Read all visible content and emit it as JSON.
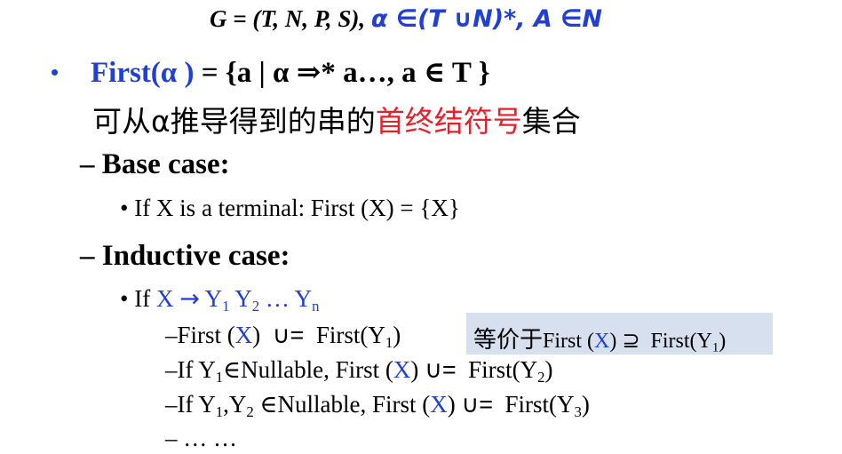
{
  "grammar": {
    "lhs": "G = (T, N, P, S),",
    "alpha_cond": "α ∈(T ∪N)*, A ∈N"
  },
  "first_def": {
    "bullet": "•",
    "head": "First(α )",
    "body": " = {a | α ⇒* a…, a ∈ T }",
    "desc_pre": "可从α推导得到的串的",
    "desc_red": "首终结符号",
    "desc_post": "集合"
  },
  "base_case": {
    "heading": "– Base case:",
    "item": "• If X is a terminal: First (X) = {X}"
  },
  "inductive_case": {
    "heading": "– Inductive case:",
    "item_prefix": "• If ",
    "prod_lhs": "X",
    "arrow": "→",
    "y": "Y",
    "sub1": "1",
    "sub2": "2",
    "sub3": "3",
    "subn": "n",
    "ellipsis": "…",
    "dash": "–",
    "if": "If ",
    "first": "First",
    "x": "X",
    "union_eq": "∪=",
    "nullable_1": "∈Nullable, ",
    "nullable_2": " ∈Nullable, ",
    "equiv_zh": "等价于",
    "supseteq": "⊇",
    "more": "– … …"
  }
}
